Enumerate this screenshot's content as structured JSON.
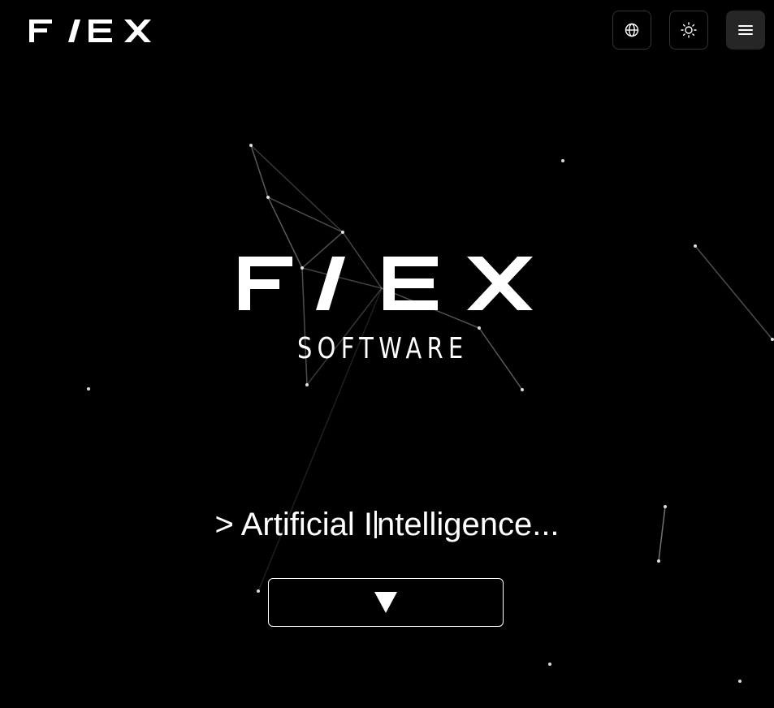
{
  "brand": {
    "logo_name": "F/EX logo",
    "tagline": "SOFTWARE"
  },
  "header": {
    "language_icon": "globe-icon",
    "theme_icon": "sun-icon",
    "menu_icon": "hamburger-menu-icon"
  },
  "hero": {
    "prompt": ">",
    "typed_text_before": "Artificial I",
    "typed_text_after": "ntelligence...",
    "scroll_icon": "triangle-down-icon"
  },
  "colors": {
    "background": "#000000",
    "foreground": "#ffffff",
    "menu_button_bg": "#262626",
    "icon_button_border": "#333333"
  }
}
